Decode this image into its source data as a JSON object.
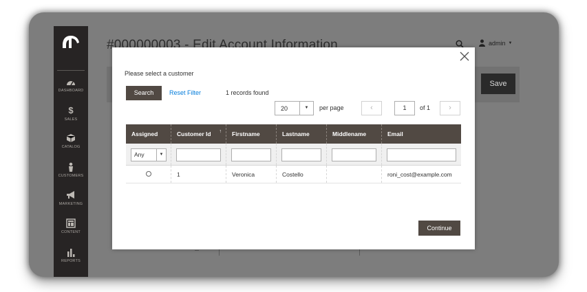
{
  "page": {
    "title": "#000000003 - Edit Account Information",
    "save_label": "Save",
    "admin_user": "admin"
  },
  "sidebar": {
    "items": [
      {
        "label": "DASHBOARD",
        "icon": "dashboard-icon"
      },
      {
        "label": "SALES",
        "icon": "dollar-icon"
      },
      {
        "label": "CATALOG",
        "icon": "cube-icon"
      },
      {
        "label": "CUSTOMERS",
        "icon": "person-icon"
      },
      {
        "label": "MARKETING",
        "icon": "megaphone-icon"
      },
      {
        "label": "CONTENT",
        "icon": "layout-icon"
      },
      {
        "label": "REPORTS",
        "icon": "bar-chart-icon"
      }
    ]
  },
  "modal": {
    "title": "Please select a customer",
    "search_label": "Search",
    "reset_label": "Reset Filter",
    "records_found": "1 records found",
    "per_page_value": "20",
    "per_page_label": "per page",
    "page_value": "1",
    "page_of": "of 1",
    "continue_label": "Continue",
    "columns": [
      "Assigned",
      "Customer Id",
      "Firstname",
      "Lastname",
      "Middlename",
      "Email"
    ],
    "filter_any": "Any",
    "rows": [
      {
        "customer_id": "1",
        "firstname": "Veronica",
        "lastname": "Costello",
        "middlename": "",
        "email": "roni_cost@example.com"
      }
    ]
  },
  "colors": {
    "sidebar_bg": "#272424",
    "primary_button": "#514943",
    "link": "#007bdb",
    "overlay": "#7d7d7d"
  }
}
